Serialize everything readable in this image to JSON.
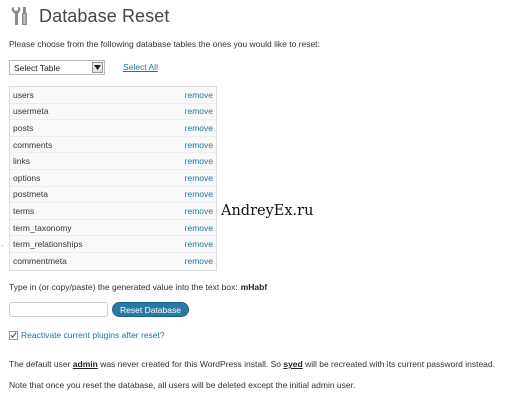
{
  "header": {
    "title": "Database Reset",
    "icon": "tools-icon"
  },
  "intro": "Please choose from the following database tables the ones you would like to reset:",
  "select": {
    "value": "Select Table",
    "select_all": "Select All"
  },
  "tables": [
    {
      "name": "users",
      "action": "remove"
    },
    {
      "name": "usermeta",
      "action": "remove"
    },
    {
      "name": "posts",
      "action": "remove"
    },
    {
      "name": "comments",
      "action": "remove"
    },
    {
      "name": "links",
      "action": "remove"
    },
    {
      "name": "options",
      "action": "remove"
    },
    {
      "name": "postmeta",
      "action": "remove"
    },
    {
      "name": "terms",
      "action": "remove"
    },
    {
      "name": "term_taxonomy",
      "action": "remove"
    },
    {
      "name": "term_relationships",
      "action": "remove"
    },
    {
      "name": "commentmeta",
      "action": "remove"
    }
  ],
  "watermark": "AndreyEx.ru",
  "prompt": {
    "text": "Type in (or copy/paste) the generated value into the text box:",
    "code": "mHabf"
  },
  "reset_button": "Reset Database",
  "checkbox": {
    "label": "Reactivate current plugins after reset?",
    "checked": true
  },
  "notes": {
    "line1_a": "The default user ",
    "line1_user": "admin",
    "line1_b": " was never created for this WordPress install. So ",
    "line1_user2": "syed",
    "line1_c": " will be recreated with its current password instead.",
    "line2": "Note that once you reset the database, all users will be deleted except the initial admin user."
  }
}
